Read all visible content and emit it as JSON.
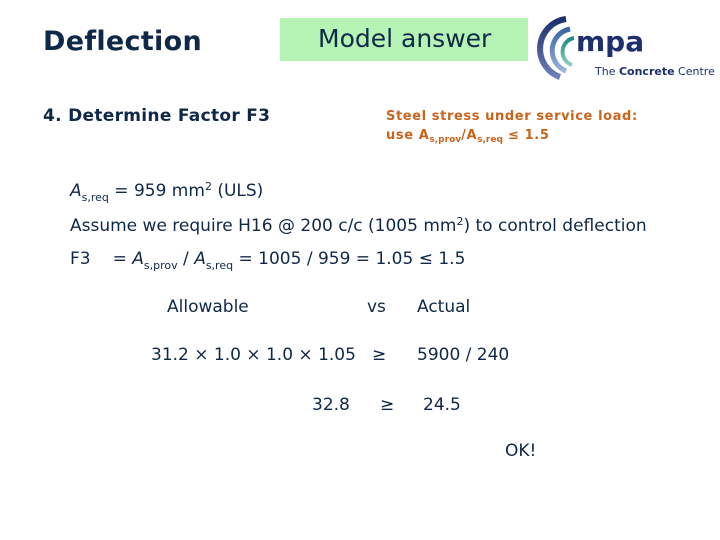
{
  "header": {
    "title": "Deflection",
    "badge": "Model answer",
    "badge_color": "#b6f4b6",
    "text_color": "#0f2847"
  },
  "logo": {
    "brand": "mpa",
    "tagline_pre": "The ",
    "tagline_bold": "Concrete",
    "tagline_post": " Centre"
  },
  "step": {
    "label": "4. Determine Factor F3"
  },
  "note": {
    "color": "#c8641c",
    "line1": "Steel stress under service load:",
    "line2_prefix": "use A",
    "sub_prov": "s,prov",
    "slash": "/A",
    "sub_req": "s,req",
    "line2_suffix": " ≤ 1.5"
  },
  "calc": {
    "line1": {
      "var": "A",
      "sub": "s,req",
      "text": " = 959 mm",
      "sup": "2",
      "tail": " (ULS)"
    },
    "line2": {
      "text": "Assume we require H16 @ 200 c/c (1005 mm",
      "sup": "2",
      "tail": ") to control deflection"
    },
    "line3": {
      "label": "F3",
      "eq": "= ",
      "var1": "A",
      "sub1": "s,prov",
      "slash": " / ",
      "var2": "A",
      "sub2": "s,req",
      "tail": " = 1005 / 959 = 1.05 ≤ 1.5"
    }
  },
  "comparison": {
    "allowable_header": "Allowable",
    "vs": "vs",
    "actual_header": "Actual",
    "allowable_expr": "31.2 × 1.0 × 1.0 × 1.05",
    "ge_symbol": "≥",
    "actual_expr": "5900 / 240",
    "allowable_value": "32.8",
    "actual_value": "24.5",
    "verdict": "OK!"
  }
}
